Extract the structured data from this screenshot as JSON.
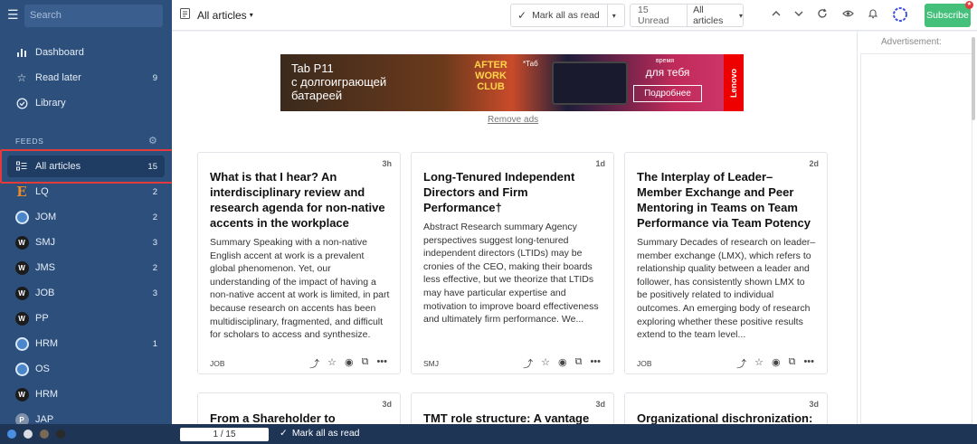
{
  "sidebar": {
    "search_placeholder": "Search",
    "nav": [
      {
        "label": "Dashboard",
        "icon": "bar-chart-icon",
        "count": ""
      },
      {
        "label": "Read later",
        "icon": "star-icon",
        "count": "9"
      },
      {
        "label": "Library",
        "icon": "circle-check-icon",
        "count": ""
      }
    ],
    "feeds_heading": "FEEDS",
    "feeds": [
      {
        "label": "All articles",
        "count": "15",
        "favicon": "list-icon",
        "active": true
      },
      {
        "label": "LQ",
        "count": "2",
        "favicon": "lq-icon"
      },
      {
        "label": "JOM",
        "count": "2",
        "favicon": "globe-icon"
      },
      {
        "label": "SMJ",
        "count": "3",
        "favicon": "w-icon"
      },
      {
        "label": "JMS",
        "count": "2",
        "favicon": "w-icon"
      },
      {
        "label": "JOB",
        "count": "3",
        "favicon": "w-icon"
      },
      {
        "label": "PP",
        "count": "",
        "favicon": "w-icon"
      },
      {
        "label": "HRM",
        "count": "1",
        "favicon": "globe-icon"
      },
      {
        "label": "OS",
        "count": "",
        "favicon": "globe-icon"
      },
      {
        "label": "HRM",
        "count": "",
        "favicon": "w-icon"
      },
      {
        "label": "JAP",
        "count": "",
        "favicon": "p-icon"
      }
    ]
  },
  "topbar": {
    "title": "All articles",
    "mark_all": "Mark all as read",
    "unread": "15 Unread",
    "filter": "All articles",
    "subscribe": "Subscribe"
  },
  "ad": {
    "headline": "Tab P11\nс долгоиграющей\nбатареей",
    "tag": "*Таб",
    "club": "AFTER WORK CLUB",
    "right_small": "время",
    "right_big": "для тебя",
    "button": "Подробнее",
    "brand": "Lenovo",
    "remove": "Remove ads"
  },
  "articles": [
    {
      "age": "3h",
      "title": "What is that I hear? An interdisciplinary review and research agenda for non-native accents in the workplace",
      "summary": "Summary Speaking with a non-native English accent at work is a prevalent global phenomenon. Yet, our understanding of the impact of having a non-native accent at work is limited, in part because research on accents has been multidisciplinary, fragmented, and difficult for scholars to access and synthesize.",
      "source": "JOB"
    },
    {
      "age": "1d",
      "title": "Long-Tenured Independent Directors and Firm Performance†",
      "summary": "Abstract Research summary Agency perspectives suggest long-tenured independent directors (LTIDs) may be cronies of the CEO, making their boards less effective, but we theorize that LTIDs may have particular expertise and motivation to improve board effectiveness and ultimately firm performance. We...",
      "source": "SMJ"
    },
    {
      "age": "2d",
      "title": "The Interplay of Leader–Member Exchange and Peer Mentoring in Teams on Team Performance via Team Potency",
      "summary": "Summary Decades of research on leader–member exchange (LMX), which refers to relationship quality between a leader and follower, has consistently shown LMX to be positively related to individual outcomes. An emerging body of research exploring whether these positive results extend to the team level...",
      "source": "JOB"
    }
  ],
  "articles_next": [
    {
      "age": "3d",
      "title": "From a Shareholder to"
    },
    {
      "age": "3d",
      "title": "TMT role structure: A vantage"
    },
    {
      "age": "3d",
      "title": "Organizational dischronization:"
    }
  ],
  "rail": {
    "ad_label": "Advertisement:"
  },
  "bottom": {
    "pager": "1 / 15",
    "mark_all": "Mark all as read"
  }
}
